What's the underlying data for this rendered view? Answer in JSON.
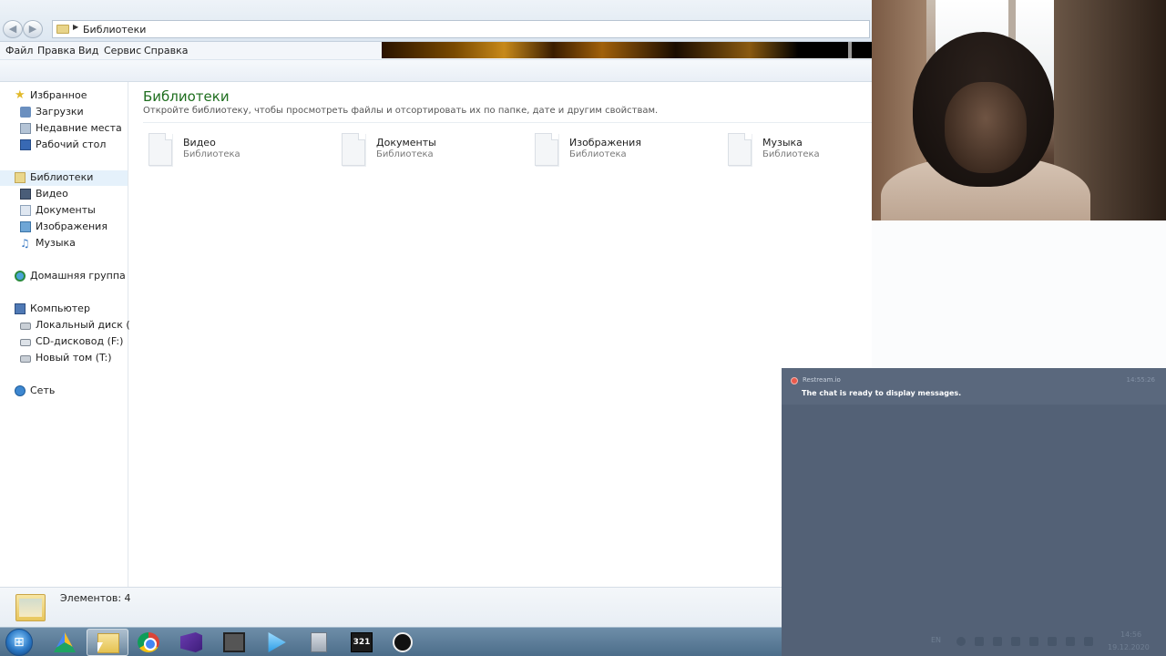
{
  "address": {
    "path": "Библиотеки"
  },
  "menu": [
    "Файл",
    "Правка",
    "Вид",
    "Сервис",
    "Справка"
  ],
  "navpane": {
    "favorites": {
      "label": "Избранное",
      "items": [
        "Загрузки",
        "Недавние места",
        "Рабочий стол"
      ]
    },
    "libraries": {
      "label": "Библиотеки",
      "items": [
        "Видео",
        "Документы",
        "Изображения",
        "Музыка"
      ]
    },
    "homegroup": {
      "label": "Домашняя группа"
    },
    "computer": {
      "label": "Компьютер",
      "items": [
        "Локальный диск (C:)",
        "CD-дисковод (F:)",
        "Новый том (T:)"
      ]
    },
    "network": {
      "label": "Сеть"
    }
  },
  "content": {
    "title": "Библиотеки",
    "subtitle": "Откройте библиотеку, чтобы просмотреть файлы и отсортировать их по папке, дате и другим свойствам.",
    "libraries": [
      {
        "name": "Видео",
        "type": "Библиотека"
      },
      {
        "name": "Документы",
        "type": "Библиотека"
      },
      {
        "name": "Изображения",
        "type": "Библиотека"
      },
      {
        "name": "Музыка",
        "type": "Библиотека"
      }
    ]
  },
  "details": {
    "count_text": "Элементов: 4"
  },
  "chat": {
    "source": "Restream.io",
    "time": "14:55:26",
    "message": "The chat is ready to display messages.",
    "accent": "#ea5a4c"
  },
  "taskbar": {
    "apps": [
      "start-button",
      "google-drive-icon",
      "windows-explorer-icon",
      "chrome-icon",
      "visual-studio-icon",
      "movie-maker-icon",
      "media-player-icon",
      "calculator-icon",
      "media-player-classic-icon",
      "obs-icon"
    ],
    "active_app": "windows-explorer-icon",
    "mpc_label": "321"
  },
  "tray": {
    "language": "EN",
    "time": "14:56",
    "date": "19.12.2020"
  }
}
